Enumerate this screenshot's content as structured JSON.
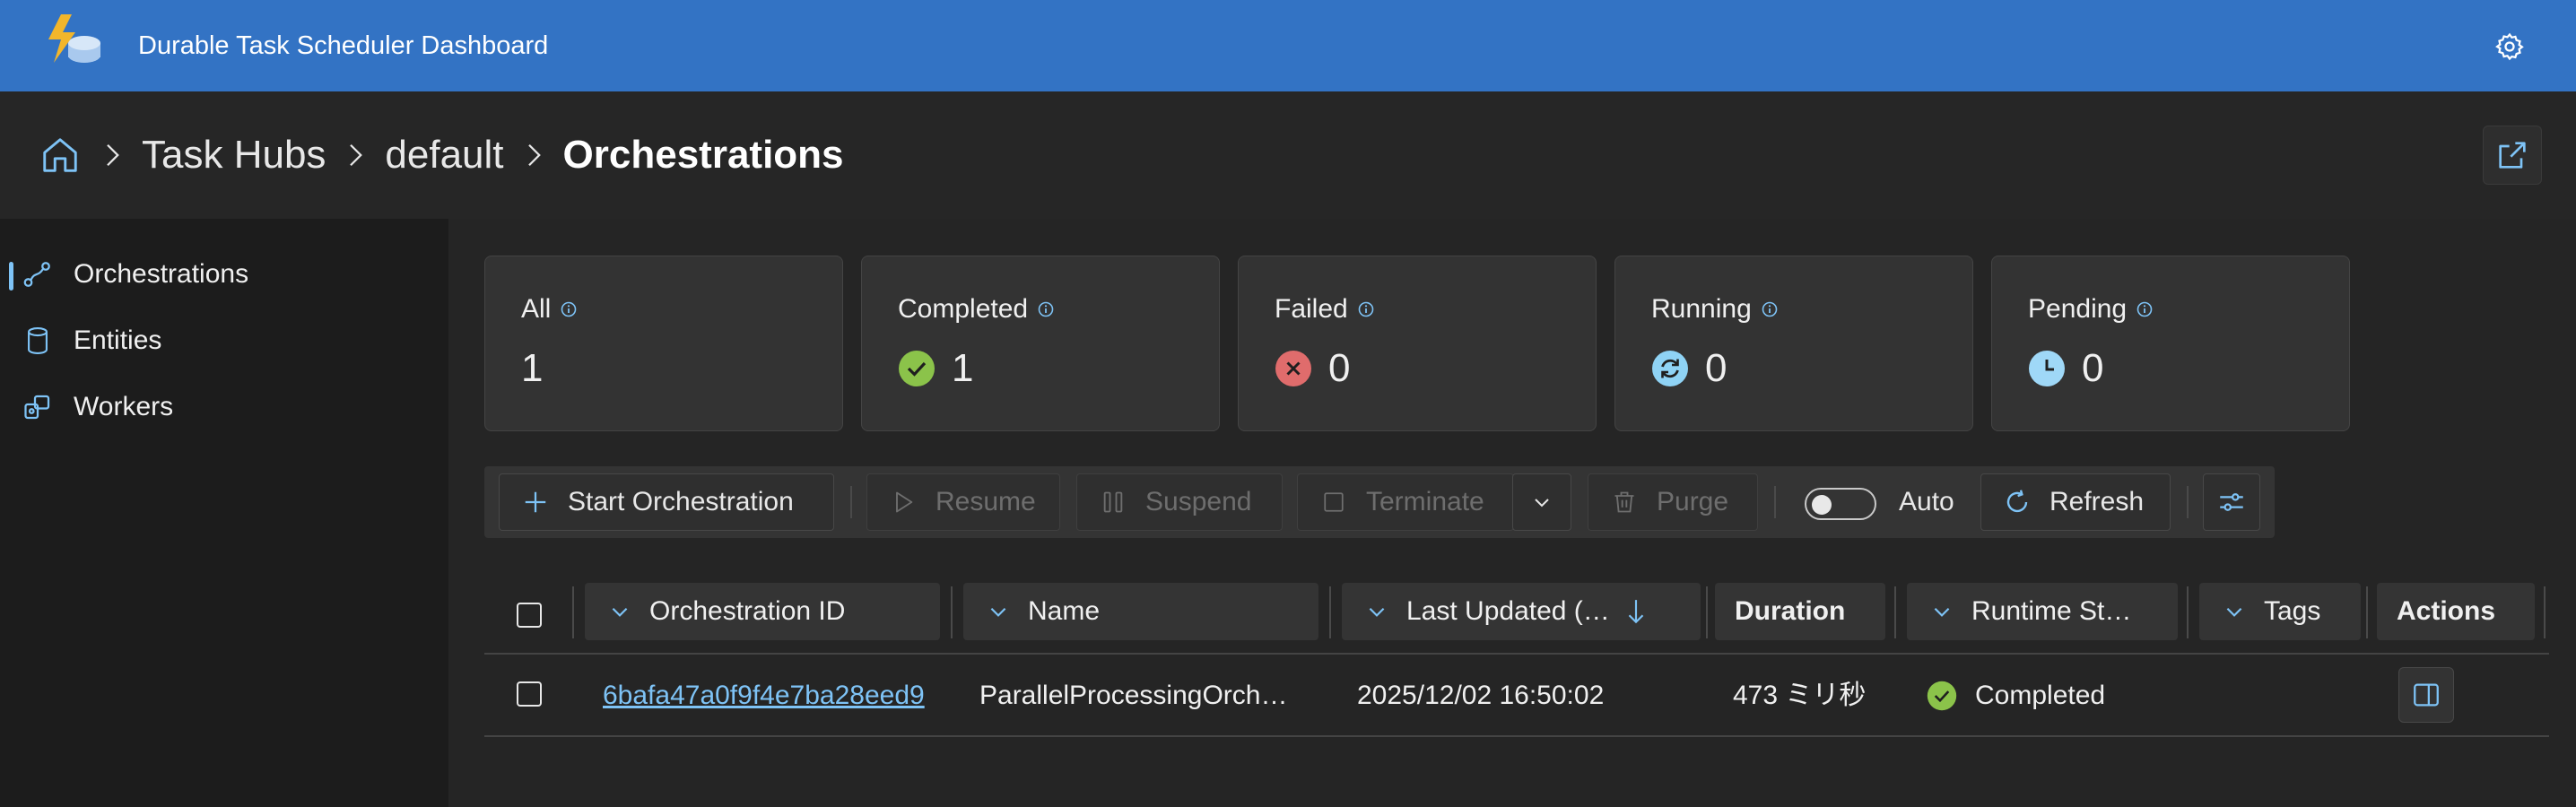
{
  "app": {
    "title": "Durable Task Scheduler Dashboard"
  },
  "breadcrumb": {
    "items": [
      "Task Hubs",
      "default",
      "Orchestrations"
    ]
  },
  "sidebar": {
    "items": [
      {
        "label": "Orchestrations",
        "icon": "orchestrations-icon",
        "active": true
      },
      {
        "label": "Entities",
        "icon": "database-icon",
        "active": false
      },
      {
        "label": "Workers",
        "icon": "workers-icon",
        "active": false
      }
    ]
  },
  "summary": {
    "cards": [
      {
        "title": "All",
        "count": "1"
      },
      {
        "title": "Completed",
        "count": "1",
        "status": "completed"
      },
      {
        "title": "Failed",
        "count": "0",
        "status": "failed"
      },
      {
        "title": "Running",
        "count": "0",
        "status": "running"
      },
      {
        "title": "Pending",
        "count": "0",
        "status": "pending"
      }
    ]
  },
  "toolbar": {
    "start_label": "Start Orchestration",
    "resume_label": "Resume",
    "suspend_label": "Suspend",
    "terminate_label": "Terminate",
    "purge_label": "Purge",
    "auto_label": "Auto",
    "auto_enabled": false,
    "refresh_label": "Refresh"
  },
  "table": {
    "columns": {
      "id": "Orchestration ID",
      "name": "Name",
      "updated": "Last Updated (…",
      "duration": "Duration",
      "runtime": "Runtime St…",
      "tags": "Tags",
      "actions": "Actions"
    },
    "rows": [
      {
        "id": "6bafa47a0f9f4e7ba28eed9",
        "name": "ParallelProcessingOrch…",
        "updated": "2025/12/02 16:50:02",
        "duration": "473 ミリ秒",
        "status": "Completed"
      }
    ]
  },
  "colors": {
    "header": "#3373c4",
    "accent": "#7ec3f6",
    "completed": "#8bc34a",
    "failed": "#e06c6c",
    "running": "#8fd3f5",
    "pending": "#9fd8f7"
  }
}
